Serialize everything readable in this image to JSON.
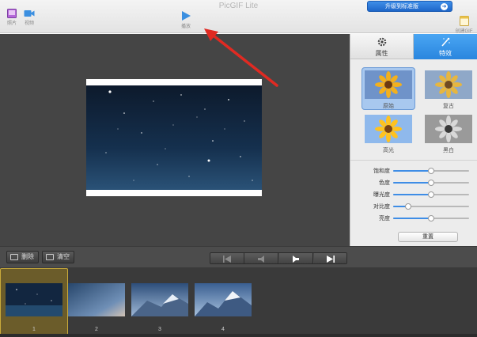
{
  "window": {
    "title": "PicGIF Lite"
  },
  "toolbar": {
    "photo_label": "照片",
    "video_label": "视频",
    "play_label": "播放",
    "create_gif_label": "创建GIF",
    "upgrade_label": "升级到标准版"
  },
  "panel": {
    "tabs": [
      {
        "label": "属性",
        "icon": "gear-icon"
      },
      {
        "label": "特效",
        "icon": "magic-wand-icon"
      }
    ],
    "active_tab": "特效",
    "effects": [
      {
        "label": "原始",
        "selected": true
      },
      {
        "label": "复古",
        "selected": false
      },
      {
        "label": "高光",
        "selected": false
      },
      {
        "label": "黑白",
        "selected": false
      }
    ],
    "sliders": [
      {
        "label": "饱和度",
        "value": 0.5
      },
      {
        "label": "色度",
        "value": 0.5
      },
      {
        "label": "曝光度",
        "value": 0.5
      },
      {
        "label": "对比度",
        "value": 0.2
      },
      {
        "label": "亮度",
        "value": 0.5
      }
    ],
    "reset_label": "重置"
  },
  "controls": {
    "delete_label": "删除",
    "clear_label": "清空",
    "nav_buttons": [
      "skip-to-first-icon",
      "step-back-icon",
      "step-forward-icon",
      "skip-to-last-icon"
    ]
  },
  "timeline": {
    "frames": [
      "1",
      "2",
      "3",
      "4"
    ],
    "selected_frame": "1"
  },
  "colors": {
    "accent_blue": "#2a86de",
    "annotation_red": "#e02a22",
    "selection_gold": "#c8a93a"
  }
}
